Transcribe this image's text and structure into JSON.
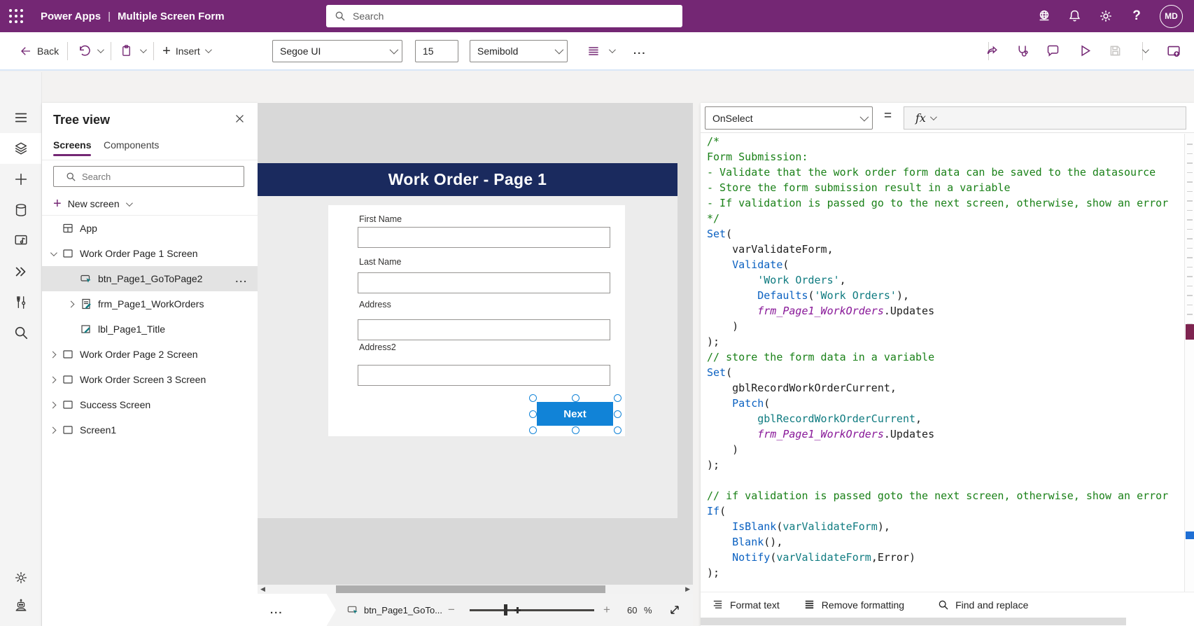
{
  "theme": {
    "brand_purple": "#742774",
    "screen_titlebar_blue": "#1a2a5e",
    "button_blue": "#1183d7",
    "selection_handle_blue": "#1183d7",
    "code_comment_green": "#1a8118",
    "code_function_blue": "#0b61c1",
    "code_string_teal": "#0f7b80",
    "code_control_purple": "#881798"
  },
  "header": {
    "product": "Power Apps",
    "separator": "|",
    "app_title": "Multiple Screen Form",
    "search_placeholder": "Search",
    "avatar_initials": "MD",
    "icons": [
      "environment-icon",
      "notifications-icon",
      "settings-icon",
      "help-icon"
    ]
  },
  "toolbar": {
    "back_label": "Back",
    "insert_label": "Insert",
    "font_family_value": "Segoe UI",
    "font_size_value": "15",
    "font_weight_value": "Semibold",
    "more_dots": "...",
    "right_icons": [
      "share-icon",
      "app-checker-icon",
      "comments-icon",
      "preview-icon",
      "save-icon",
      "publish-icon"
    ]
  },
  "left_rail": {
    "items": [
      {
        "name": "menu",
        "icon": "hamburger-icon",
        "active": false
      },
      {
        "name": "tree-view",
        "icon": "layers-icon",
        "active": true
      },
      {
        "name": "insert",
        "icon": "plus-icon",
        "active": false
      },
      {
        "name": "data",
        "icon": "cylinder-icon",
        "active": false
      },
      {
        "name": "media",
        "icon": "media-icon",
        "active": false
      },
      {
        "name": "power-automate",
        "icon": "flow-icon",
        "active": false
      },
      {
        "name": "advanced-tools",
        "icon": "tools-icon",
        "active": false
      },
      {
        "name": "search",
        "icon": "search-icon",
        "active": false
      }
    ],
    "bottom_items": [
      {
        "name": "settings",
        "icon": "gear-icon"
      },
      {
        "name": "virtual-agent",
        "icon": "robot-icon"
      }
    ]
  },
  "tree_panel": {
    "title": "Tree view",
    "tabs": [
      {
        "label": "Screens",
        "active": true
      },
      {
        "label": "Components",
        "active": false
      }
    ],
    "search_placeholder": "Search",
    "new_screen_label": "New screen",
    "items": [
      {
        "label": "App",
        "icon": "app-icon",
        "depth": 0,
        "chevron": "none",
        "selected": false
      },
      {
        "label": "Work Order Page 1 Screen",
        "icon": "screen-icon",
        "depth": 0,
        "chevron": "down",
        "selected": false
      },
      {
        "label": "btn_Page1_GoToPage2",
        "icon": "button-control-icon",
        "depth": 1,
        "chevron": "none",
        "selected": true,
        "more": "..."
      },
      {
        "label": "frm_Page1_WorkOrders",
        "icon": "form-control-icon",
        "depth": 1,
        "chevron": "right",
        "selected": false
      },
      {
        "label": "lbl_Page1_Title",
        "icon": "label-control-icon",
        "depth": 1,
        "chevron": "none",
        "selected": false
      },
      {
        "label": "Work Order Page 2 Screen",
        "icon": "screen-icon",
        "depth": 0,
        "chevron": "right",
        "selected": false
      },
      {
        "label": "Work Order Screen 3 Screen",
        "icon": "screen-icon",
        "depth": 0,
        "chevron": "right",
        "selected": false
      },
      {
        "label": "Success Screen",
        "icon": "screen-icon",
        "depth": 0,
        "chevron": "right",
        "selected": false
      },
      {
        "label": "Screen1",
        "icon": "screen-icon",
        "depth": 0,
        "chevron": "right",
        "selected": false
      }
    ]
  },
  "canvas": {
    "screen_title": "Work Order - Page 1",
    "form_fields": [
      {
        "label": "First Name"
      },
      {
        "label": "Last Name"
      },
      {
        "label": "Address"
      },
      {
        "label": "Address2"
      }
    ],
    "next_button_label": "Next",
    "status_bar": {
      "breadcrumb_dots": "...",
      "selected_control": "btn_Page1_GoTo...",
      "zoom_value": "60",
      "zoom_unit": "%"
    }
  },
  "formula_bar": {
    "property_value": "OnSelect",
    "equals": "=",
    "fx_label": "fx"
  },
  "code": {
    "lines": [
      [
        {
          "t": "/*",
          "c": "cm"
        }
      ],
      [
        {
          "t": "Form Submission:",
          "c": "cm"
        }
      ],
      [
        {
          "t": "- Validate that the work order form data can be saved to the datasource",
          "c": "cm"
        }
      ],
      [
        {
          "t": "- Store the form submission result in a variable",
          "c": "cm"
        }
      ],
      [
        {
          "t": "- If validation is passed go to the next screen, otherwise, show an error",
          "c": "cm"
        }
      ],
      [
        {
          "t": "*/",
          "c": "cm"
        }
      ],
      [
        {
          "t": "Set",
          "c": "kw"
        },
        {
          "t": "(",
          "c": "pl"
        }
      ],
      [
        {
          "t": "    varValidateForm,",
          "c": "pl"
        }
      ],
      [
        {
          "t": "    ",
          "c": "pl"
        },
        {
          "t": "Validate",
          "c": "kw"
        },
        {
          "t": "(",
          "c": "pl"
        }
      ],
      [
        {
          "t": "        ",
          "c": "pl"
        },
        {
          "t": "'Work Orders'",
          "c": "str"
        },
        {
          "t": ",",
          "c": "pl"
        }
      ],
      [
        {
          "t": "        ",
          "c": "pl"
        },
        {
          "t": "Defaults",
          "c": "kw"
        },
        {
          "t": "(",
          "c": "pl"
        },
        {
          "t": "'Work Orders'",
          "c": "str"
        },
        {
          "t": "),",
          "c": "pl"
        }
      ],
      [
        {
          "t": "        ",
          "c": "pl"
        },
        {
          "t": "frm_Page1_WorkOrders",
          "c": "ctl"
        },
        {
          "t": ".Updates",
          "c": "pl"
        }
      ],
      [
        {
          "t": "    )",
          "c": "pl"
        }
      ],
      [
        {
          "t": ");",
          "c": "pl"
        }
      ],
      [
        {
          "t": "// store the form data in a variable",
          "c": "cm"
        }
      ],
      [
        {
          "t": "Set",
          "c": "kw"
        },
        {
          "t": "(",
          "c": "pl"
        }
      ],
      [
        {
          "t": "    gblRecordWorkOrderCurrent,",
          "c": "pl"
        }
      ],
      [
        {
          "t": "    ",
          "c": "pl"
        },
        {
          "t": "Patch",
          "c": "kw"
        },
        {
          "t": "(",
          "c": "pl"
        }
      ],
      [
        {
          "t": "        ",
          "c": "pl"
        },
        {
          "t": "gblRecordWorkOrderCurrent",
          "c": "str"
        },
        {
          "t": ",",
          "c": "pl"
        }
      ],
      [
        {
          "t": "        ",
          "c": "pl"
        },
        {
          "t": "frm_Page1_WorkOrders",
          "c": "ctl"
        },
        {
          "t": ".Updates",
          "c": "pl"
        }
      ],
      [
        {
          "t": "    )",
          "c": "pl"
        }
      ],
      [
        {
          "t": ");",
          "c": "pl"
        }
      ],
      [
        {
          "t": "",
          "c": "pl"
        }
      ],
      [
        {
          "t": "// if validation is passed goto the next screen, otherwise, show an error",
          "c": "cm"
        }
      ],
      [
        {
          "t": "If",
          "c": "kw"
        },
        {
          "t": "(",
          "c": "pl"
        }
      ],
      [
        {
          "t": "    ",
          "c": "pl"
        },
        {
          "t": "IsBlank",
          "c": "kw"
        },
        {
          "t": "(",
          "c": "pl"
        },
        {
          "t": "varValidateForm",
          "c": "str"
        },
        {
          "t": "),",
          "c": "pl"
        }
      ],
      [
        {
          "t": "    ",
          "c": "pl"
        },
        {
          "t": "Blank",
          "c": "kw"
        },
        {
          "t": "(),",
          "c": "pl"
        }
      ],
      [
        {
          "t": "    ",
          "c": "pl"
        },
        {
          "t": "Notify",
          "c": "kw"
        },
        {
          "t": "(",
          "c": "pl"
        },
        {
          "t": "varValidateForm",
          "c": "str"
        },
        {
          "t": ",Error)",
          "c": "pl"
        }
      ],
      [
        {
          "t": ");",
          "c": "pl"
        }
      ]
    ]
  },
  "code_footer": {
    "format_text": "Format text",
    "remove_formatting": "Remove formatting",
    "find_and_replace": "Find and replace"
  }
}
